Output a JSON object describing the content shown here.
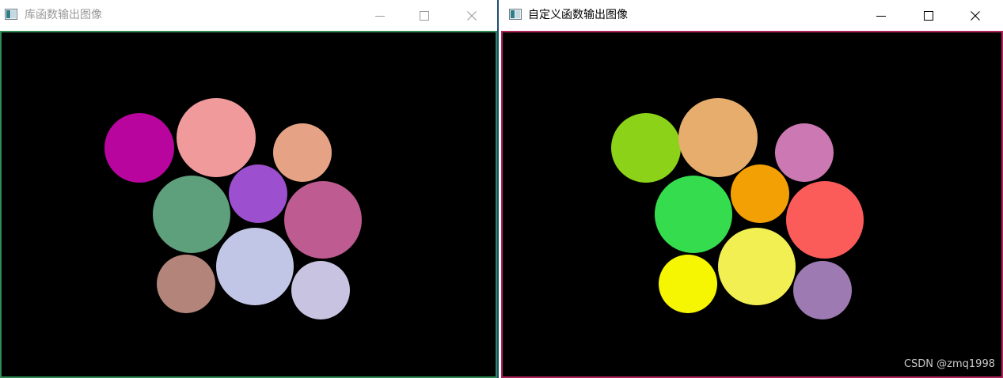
{
  "windows": [
    {
      "title": "库函数输出图像",
      "active": false,
      "border_color": "#2e8b57",
      "circles": [
        {
          "color": "#b8059e"
        },
        {
          "color": "#f09a9c"
        },
        {
          "color": "#e6a285"
        },
        {
          "color": "#5e9f7c"
        },
        {
          "color": "#9c4fce"
        },
        {
          "color": "#be5b91"
        },
        {
          "color": "#b3857a"
        },
        {
          "color": "#c2c6e6"
        },
        {
          "color": "#c9c3e2"
        }
      ]
    },
    {
      "title": "自定义函数输出图像",
      "active": true,
      "border_color": "#b0245a",
      "watermark": "CSDN @zmq1998",
      "circles": [
        {
          "color": "#8bd219"
        },
        {
          "color": "#e6ad6d"
        },
        {
          "color": "#cc78b3"
        },
        {
          "color": "#35dd4e"
        },
        {
          "color": "#f3a005"
        },
        {
          "color": "#fb5c5a"
        },
        {
          "color": "#f6f602"
        },
        {
          "color": "#f2ef52"
        },
        {
          "color": "#9d7ab1"
        }
      ]
    }
  ],
  "icons": {
    "app": "image-window-icon",
    "minimize": "minimize-icon",
    "maximize": "maximize-icon",
    "close": "close-icon"
  }
}
